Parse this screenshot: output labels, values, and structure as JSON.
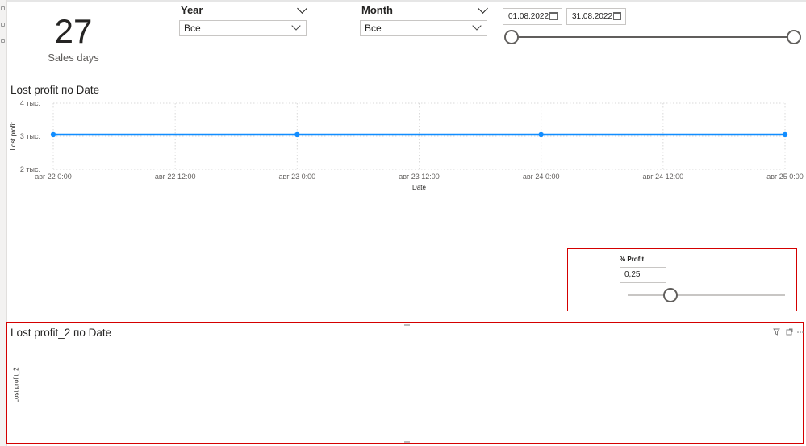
{
  "card": {
    "value": "27",
    "label": "Sales days"
  },
  "year_slicer": {
    "title": "Year",
    "selected": "Все"
  },
  "month_slicer": {
    "title": "Month",
    "selected": "Все"
  },
  "date_range": {
    "start": "01.08.2022",
    "end": "31.08.2022",
    "start_fraction": 0,
    "end_fraction": 1
  },
  "chart1": {
    "title": "Lost profit по Date",
    "chart_data": {
      "type": "line",
      "title": "Lost profit по Date",
      "xlabel": "Date",
      "ylabel": "Lost profit",
      "x_ticks": [
        "авг 22 0:00",
        "авг 22 12:00",
        "авг 23 0:00",
        "авг 23 12:00",
        "авг 24 0:00",
        "авг 24 12:00",
        "авг 25 0:00"
      ],
      "y_ticks": [
        "4 тыс.",
        "3 тыс.",
        "2 тыс."
      ],
      "ylim": [
        2000,
        4000
      ],
      "grid": true,
      "series": [
        {
          "x": [
            "авг 22 0:00",
            "авг 23 0:00",
            "авг 24 0:00",
            "авг 25 0:00"
          ],
          "values": [
            3050,
            3050,
            3050,
            3050
          ],
          "color": "#118dff"
        }
      ]
    }
  },
  "profit_param": {
    "title": "% Profit",
    "value": "0,25",
    "slider_fraction": 0.27
  },
  "chart2": {
    "title": "Lost profit_2 по Date",
    "ylabel": "Lost profit_2",
    "icons": [
      "filter-icon",
      "focus-mode-icon",
      "more-options-icon"
    ]
  },
  "colors": {
    "line": "#118dff",
    "highlight": "#d40000"
  }
}
